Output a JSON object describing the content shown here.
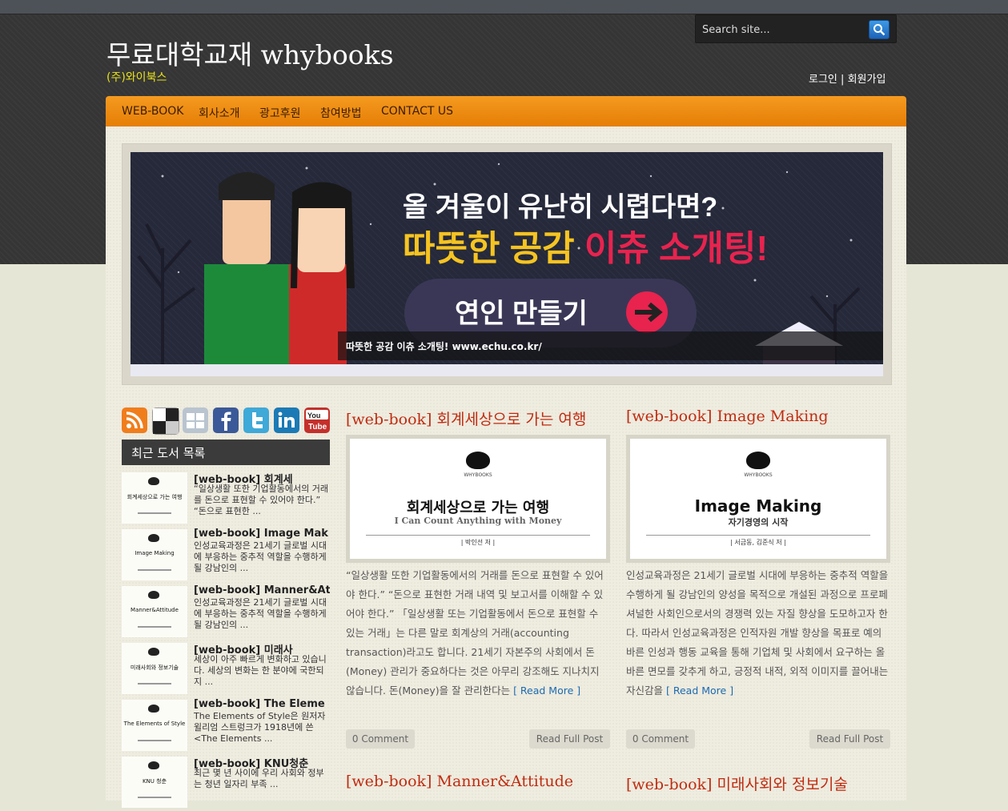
{
  "site": {
    "title": "무료대학교재 whybooks",
    "subtitle": "(주)와이북스"
  },
  "search": {
    "placeholder": "Search site..."
  },
  "auth": {
    "login": "로그인",
    "separator": "|",
    "signup": "회원가입"
  },
  "nav": {
    "items": [
      "WEB-BOOK",
      "회사소개",
      "광고후원",
      "참여방법",
      "CONTACT US"
    ]
  },
  "banner": {
    "headline1": "올 겨울이 유난히 시렵다면?",
    "headline2a": "따뜻한 공감 ",
    "headline2b": "이츄 소개팅!",
    "button": "연인 만들기",
    "caption": "따뜻한 공감 이츄 소개팅! www.echu.co.kr/"
  },
  "social": {
    "icons": [
      "rss-icon",
      "delicious-icon",
      "digg-icon",
      "facebook-icon",
      "twitter-icon",
      "linkedin-icon",
      "youtube-icon"
    ],
    "colors": {
      "rss": "#f07d1c",
      "facebook": "#3b5998",
      "twitter": "#3fa9d8",
      "linkedin": "#1b7ab5",
      "youtube": "#c4302b"
    }
  },
  "sidebar": {
    "title": "최근 도서 목록",
    "items": [
      {
        "thumb": "회계세상으로 가는 여행",
        "title": "[web-book] 회계세",
        "text": "“일상생활 또한 기업활동에서의 거래를 돈으로 표현할 수 있어야 한다.” “돈으로 표현한 ..."
      },
      {
        "thumb": "Image Making",
        "title": "[web-book] Image Mak",
        "text": "인성교육과정은 21세기 글로벌 시대에 부응하는 중추적 역할을 수행하게 될 강남인의 ..."
      },
      {
        "thumb": "Manner&Attitude",
        "title": "[web-book] Manner&At",
        "text": "인성교육과정은 21세기 글로벌 시대에 부응하는 중추적 역할을 수행하게 될 강남인의 ..."
      },
      {
        "thumb": "미래사회와 정보기술",
        "title": "[web-book] 미래사",
        "text": "세상이 아주 빠르게 변화하고 있습니다. 세상의 변화는 한 분야에 국한되지 ..."
      },
      {
        "thumb": "The Elements of Style",
        "title": "[web-book] The Eleme",
        "text": "The Elements of Style은 원저자 윌리엄 스트렁크가 1918년에 쓴 <The Elements ..."
      },
      {
        "thumb": "KNU 청춘",
        "title": "[web-book] KNU청춘",
        "text": "최근 몇 년 사이에 우리 사회와 정부는 청년 일자리 부족 ..."
      }
    ]
  },
  "posts": [
    {
      "title": "[web-book] 회계세상으로 가는 여행",
      "cover_logo": "WHYBOOKS",
      "cover_title": "회계세상으로 가는 여행",
      "cover_sub": "I Can Count Anything with Money",
      "cover_author": "| 박인선 저 |",
      "excerpt": "“일상생활 또한 기업활동에서의 거래를 돈으로 표현할 수 있어야 한다.” “돈으로 표현한 거래 내역 및 보고서를 이해할 수 있어야 한다.” 「일상생활 또는 기업활동에서 돈으로 표현할 수 있는 거래」는 다른 말로 회계상의 거래(accounting transaction)라고도 합니다. 21세기 자본주의 사회에서 돈(Money) 관리가 중요하다는 것은 아무리 강조해도 지나치지 않습니다. 돈(Money)을 잘 관리한다는",
      "read_more": "[ Read More ]",
      "comments": "0 Comment",
      "full": "Read Full Post"
    },
    {
      "title": "[web-book] Image Making",
      "cover_logo": "WHYBOOKS",
      "cover_title": "Image Making",
      "cover_sub": "자기경영의 시작",
      "cover_author": "| 서금동, 김준식 저 |",
      "excerpt": "인성교육과정은 21세기 글로벌 시대에 부응하는 중추적 역할을 수행하게 될 강남인의 양성을 목적으로 개설된 과정으로 프로페셔널한 사회인으로서의 경쟁력 있는 자질 향상을 도모하고자 한다. 따라서 인성교육과정은 인적자원 개발 향상을 목표로 예의 바른 인성과 행동 교육을 통해 기업체 및 사회에서 요구하는 올바른 면모를 갖추게 하고, 긍정적 내적, 외적 이미지를 끌어내는 자신감을",
      "read_more": "[ Read More ]",
      "comments": "0 Comment",
      "full": "Read Full Post"
    },
    {
      "title": "[web-book] Manner&Attitude"
    },
    {
      "title": "[web-book] 미래사회와 정보기술"
    }
  ]
}
